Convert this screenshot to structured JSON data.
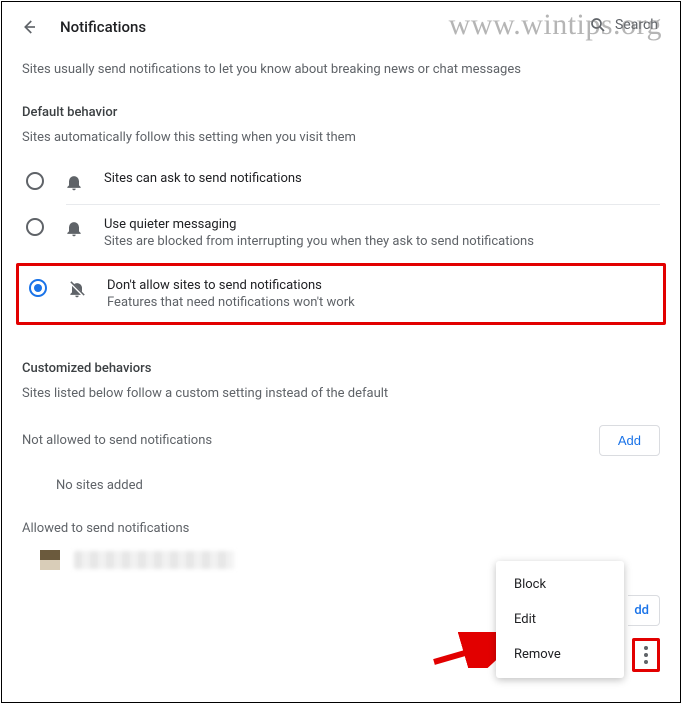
{
  "header": {
    "title": "Notifications",
    "search_placeholder": "Search"
  },
  "description": "Sites usually send notifications to let you know about breaking news or chat messages",
  "default_behavior": {
    "heading": "Default behavior",
    "subheading": "Sites automatically follow this setting when you visit them",
    "options": [
      {
        "label": "Sites can ask to send notifications",
        "sublabel": "",
        "selected": false,
        "icon": "bell"
      },
      {
        "label": "Use quieter messaging",
        "sublabel": "Sites are blocked from interrupting you when they ask to send notifications",
        "selected": false,
        "icon": "bell"
      },
      {
        "label": "Don't allow sites to send notifications",
        "sublabel": "Features that need notifications won't work",
        "selected": true,
        "icon": "bell-off"
      }
    ]
  },
  "customized": {
    "heading": "Customized behaviors",
    "subheading": "Sites listed below follow a custom setting instead of the default"
  },
  "not_allowed": {
    "heading": "Not allowed to send notifications",
    "add_label": "Add",
    "empty_text": "No sites added"
  },
  "allowed": {
    "heading": "Allowed to send notifications",
    "add_label": "dd"
  },
  "context_menu": {
    "items": [
      "Block",
      "Edit",
      "Remove"
    ]
  },
  "watermark": "www.wintips.org"
}
